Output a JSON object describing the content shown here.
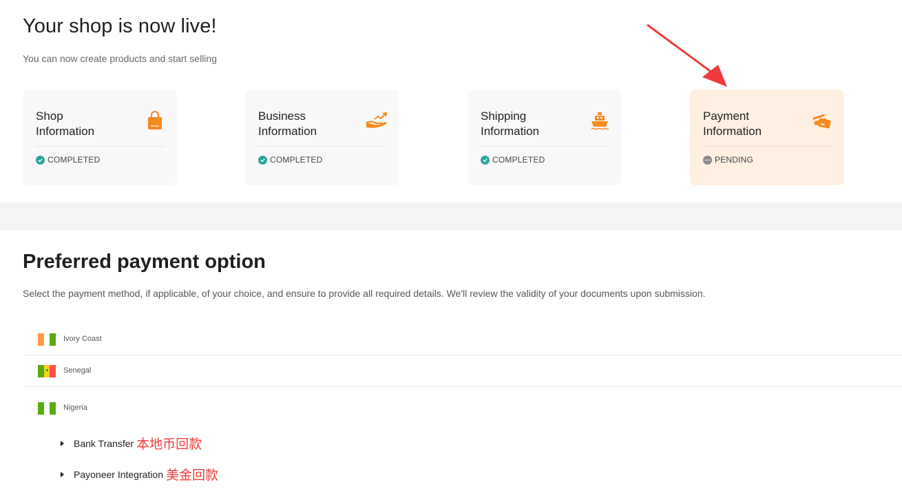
{
  "header": {
    "title": "Your shop is now live!",
    "subtitle": "You can now create products and start selling"
  },
  "cards": [
    {
      "title_line1": "Shop",
      "title_line2": "Information",
      "status": "COMPLETED",
      "icon": "shopping-bag-icon"
    },
    {
      "title_line1": "Business",
      "title_line2": "Information",
      "status": "COMPLETED",
      "icon": "hand-growth-icon"
    },
    {
      "title_line1": "Shipping",
      "title_line2": "Information",
      "status": "COMPLETED",
      "icon": "ship-icon"
    },
    {
      "title_line1": "Payment",
      "title_line2": "Information",
      "status": "PENDING",
      "icon": "payment-card-icon"
    }
  ],
  "payment": {
    "title": "Preferred payment option",
    "description": "Select the payment method, if applicable, of your choice, and ensure to provide all required details. We'll review the validity of your documents upon submission.",
    "countries": [
      {
        "name": "Ivory Coast",
        "flag": [
          "#ff9a4a",
          "#ffffff",
          "#5aab10"
        ]
      },
      {
        "name": "Senegal",
        "flag": [
          "#59a90c",
          "#f7d21e",
          "#ff4d4d"
        ]
      },
      {
        "name": "Nigeria",
        "flag": [
          "#5aab10",
          "#ffffff",
          "#5aab10"
        ]
      }
    ],
    "options": [
      {
        "label": "Bank Transfer",
        "note": "本地币回款"
      },
      {
        "label": "Payoneer Integration",
        "note": "美金回款"
      }
    ]
  },
  "colors": {
    "accent": "#f58a1f",
    "completed": "#26a69a",
    "pending": "#8a8a8a",
    "annotation": "#ee3b3b"
  }
}
